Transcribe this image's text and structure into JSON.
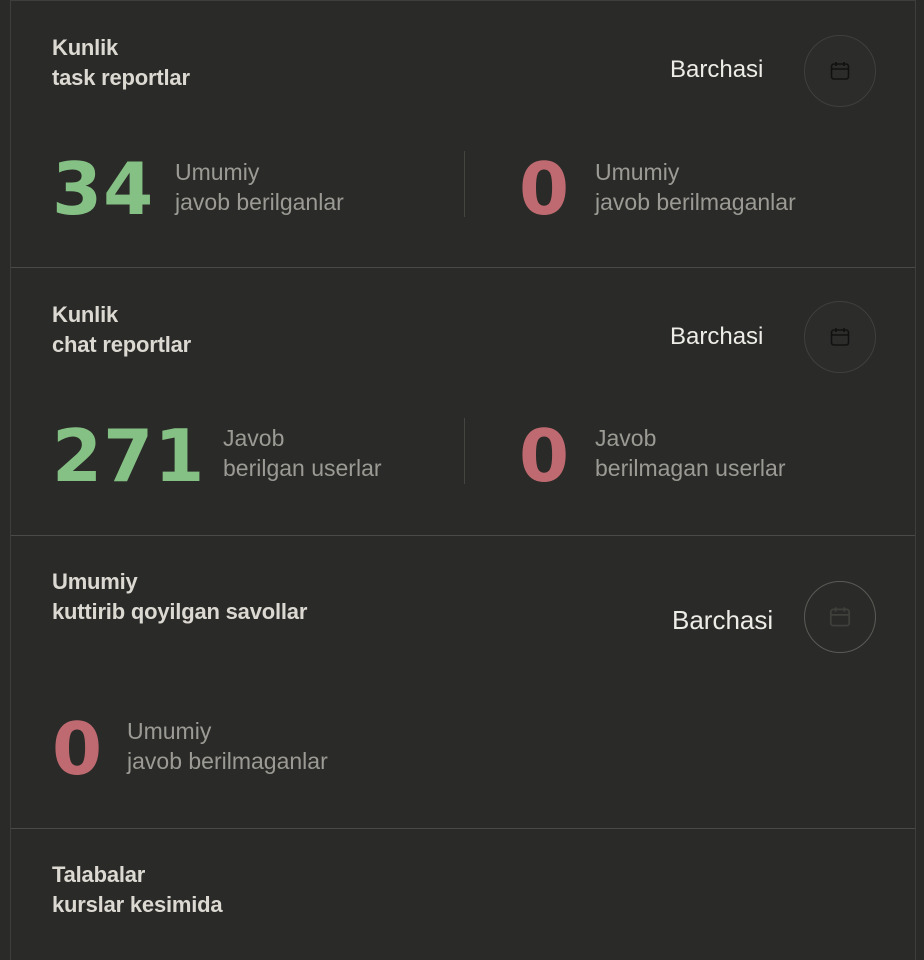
{
  "cards": [
    {
      "title_line1": "Kunlik",
      "title_line2": "task reportlar",
      "filter_label": "Barchasi",
      "calendar_icon": "calendar-icon",
      "stats": [
        {
          "value": "34",
          "label_line1": "Umumiy",
          "label_line2": "javob berilganlar",
          "color": "#85c184"
        },
        {
          "value": "0",
          "label_line1": "Umumiy",
          "label_line2": "javob berilmaganlar",
          "color": "#bf6a70"
        }
      ]
    },
    {
      "title_line1": "Kunlik",
      "title_line2": "chat reportlar",
      "filter_label": "Barchasi",
      "calendar_icon": "calendar-icon",
      "stats": [
        {
          "value": "271",
          "label_line1": "Javob",
          "label_line2": "berilgan userlar",
          "color": "#85c184"
        },
        {
          "value": "0",
          "label_line1": "Javob",
          "label_line2": "berilmagan userlar",
          "color": "#bf6a70"
        }
      ]
    },
    {
      "title_line1": "Umumiy",
      "title_line2": "kuttirib qoyilgan savollar",
      "filter_label": "Barchasi",
      "calendar_icon": "calendar-icon",
      "stats": [
        {
          "value": "0",
          "label_line1": "Umumiy",
          "label_line2": "javob berilmaganlar",
          "color": "#bf6a70"
        }
      ]
    },
    {
      "title_line1": "Talabalar",
      "title_line2": "kurslar kesimida"
    }
  ]
}
